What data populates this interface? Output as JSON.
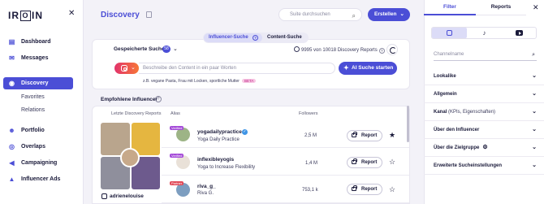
{
  "sidebar": {
    "logo_left": "IR",
    "logo_box": "O",
    "logo_right": "IN",
    "close_icon": "close-icon",
    "items": [
      {
        "label": "Dashboard",
        "icon": "dashboard-icon"
      },
      {
        "label": "Messages",
        "icon": "mail-icon"
      },
      {
        "label": "Discovery",
        "icon": "eye-icon",
        "active": true
      },
      {
        "label": "Portfolio",
        "icon": "people-icon"
      },
      {
        "label": "Overlaps",
        "icon": "overlap-icon"
      },
      {
        "label": "Campaigning",
        "icon": "megaphone-icon"
      },
      {
        "label": "Influencer Ads",
        "icon": "ads-icon"
      }
    ],
    "subitems": [
      "Favorites",
      "Relations"
    ],
    "active_color": "#4b4ed6"
  },
  "header": {
    "title": "Discovery",
    "search_placeholder": "Suite durchsuchen",
    "create_label": "Erstellen"
  },
  "search": {
    "tab_influencer": "Influencer-Suche",
    "tab_content": "Content-Suche",
    "saved_label": "Gespeicherte Suchen",
    "saved_count": "58",
    "quota": "9995 von 10018 Discovery Reports",
    "query_placeholder": "Beschreibe den Content in ein paar Worten",
    "ai_button": "AI Suche starten",
    "hint": "z.B. vegane Pasta, Frau mit Locken, sportliche Mutter",
    "hint_badge": "BETA"
  },
  "recommended": {
    "title": "Empfohlene Influencer",
    "columns": [
      "Letzte Discovery Reports",
      "Alias",
      "Followers"
    ],
    "featured_name": "adrienelouise",
    "rows": [
      {
        "handle": "yogadailypractice",
        "desc": "Yoga Daily Practice",
        "followers": "2,5 M",
        "badge": "Verified",
        "verified": true,
        "starred": true,
        "report": "Report"
      },
      {
        "handle": "inflexibleyogis",
        "desc": "Yoga to Increase Flexibility",
        "followers": "1,4 M",
        "badge": "Verified",
        "verified": false,
        "starred": false,
        "report": "Report"
      },
      {
        "handle": "riva_g_",
        "desc": "Riva G.",
        "followers": "753,1 k",
        "badge": "Partner",
        "verified": false,
        "starred": false,
        "report": "Report"
      }
    ]
  },
  "panel": {
    "tab_filter": "Filter",
    "tab_reports": "Reports",
    "channel_placeholder": "Channelname",
    "sections": [
      {
        "label": "Lookalike",
        "extra": ""
      },
      {
        "label": "Allgemein",
        "extra": ""
      },
      {
        "label": "Kanal",
        "extra": " (KPIs, Eigenschaften)"
      },
      {
        "label": "Über den Influencer",
        "extra": ""
      },
      {
        "label": "Über die Zielgruppe",
        "extra": ""
      },
      {
        "label": "Erweiterte Sucheinstellungen",
        "extra": ""
      }
    ]
  }
}
